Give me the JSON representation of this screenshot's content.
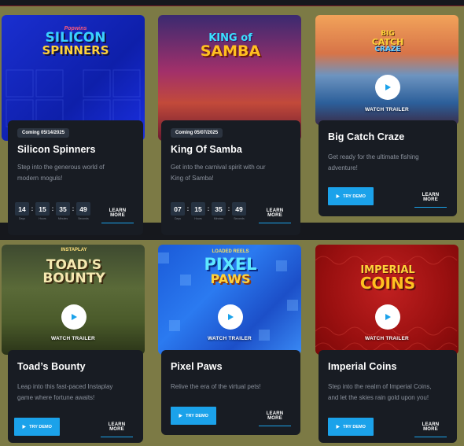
{
  "labels": {
    "watch_trailer": "WATCH TRAILER",
    "try_demo": "TRY DEMO",
    "learn_more": "LEARN MORE",
    "countdown_units": [
      "Days",
      "Hours",
      "Minutes",
      "Seconds"
    ]
  },
  "games": [
    {
      "title": "Silicon Spinners",
      "badge": "Coming 05/14/2025",
      "description": "Step into the generous world of\nmodern moguls!",
      "countdown": [
        "14",
        "15",
        "35",
        "49"
      ],
      "logo_lines": [
        "Popwins",
        "SILICON",
        "SPINNERS"
      ]
    },
    {
      "title": "King Of Samba",
      "badge": "Coming 05/07/2025",
      "description": "Get into the carnival spirit with our\nKing of Samba!",
      "countdown": [
        "07",
        "15",
        "35",
        "49"
      ],
      "logo_lines": [
        "KING of",
        "SAMBA"
      ]
    },
    {
      "title": "Big Catch Craze",
      "description": "Get ready for the ultimate fishing\nadventure!",
      "logo_lines": [
        "BIG",
        "CATCH",
        "CRAZE"
      ]
    },
    {
      "title": "Toad’s Bounty",
      "description": "Leap into this fast-paced Instaplay\ngame where fortune awaits!",
      "logo_lines": [
        "INSTAPLAY",
        "TOAD'S",
        "BOUNTY"
      ]
    },
    {
      "title": "Pixel Paws",
      "description": "Relive the era of the virtual pets!",
      "logo_lines": [
        "LOADED REELS",
        "PIXEL",
        "PAWS"
      ]
    },
    {
      "title": "Imperial Coins",
      "description": "Step into the realm of Imperial Coins,\nand let the skies rain gold upon you!",
      "logo_lines": [
        "IMPERIAL",
        "COINS"
      ]
    }
  ],
  "colors": {
    "background": "#7c7a45",
    "card": "#181c23",
    "accent": "#1ba2ea"
  }
}
